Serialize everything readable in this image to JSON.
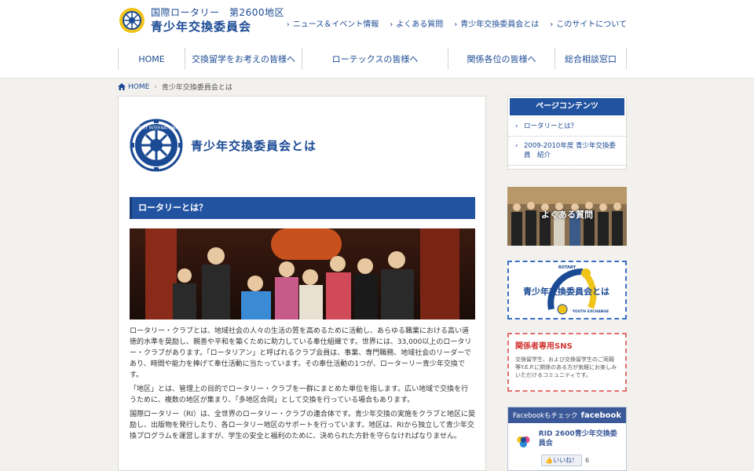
{
  "header": {
    "logo_line1": "国際ロータリー　第2600地区",
    "logo_line2": "青少年交換委員会",
    "top_links": [
      "ニュース＆イベント情報",
      "よくある質問",
      "青少年交換委員会とは",
      "このサイトについて"
    ],
    "nav": [
      "HOME",
      "交換留学をお考えの皆様へ",
      "ローテックスの皆様へ",
      "関係各位の皆様へ",
      "総合相談窓口"
    ]
  },
  "breadcrumb": {
    "home": "HOME",
    "current": "青少年交換委員会とは"
  },
  "main": {
    "title": "青少年交換委員会とは",
    "emblem_text": "ROTARY INTERNATIONAL",
    "section_heading": "ロータリーとは？",
    "paragraphs": [
      "ロータリー・クラブとは、地域社会の人々の生活の質を高めるために活動し、あらゆる職業における高い道徳的水準を奨励し、親善や平和を築くために助力している奉仕組織です。世界には、33,000以上のロータリー・クラブがあります。「ロータリアン」と呼ばれるクラブ会員は、事業、専門職務、地域社会のリーダーであり、時間や能力を捧げて奉仕活動に当たっています。その奉仕活動の1つが、ローターリー青少年交換です。",
      "「地区」とは、管理上の目的でロータリー・クラブを一群にまとめた単位を指します。広い地域で交換を行うために、複数の地区が集まり、「多地区合同」として交換を行っている場合もあります。",
      "国際ロータリー（RI）は、全世界のロータリー・クラブの連合体です。青少年交換の実施をクラブと地区に奨励し、出版物を発行したり、各ロータリー地区のサポートを行っています。地区は、RIから独立して青少年交換プログラムを運営しますが、学生の安全と福利のために、決められた方針を守らなければなりません。"
    ]
  },
  "sidebar": {
    "page_contents_title": "ページコンテンツ",
    "page_contents": [
      "ロータリーとは？",
      "2009-2010年度 青少年交換委員　紹介"
    ],
    "faq_banner": "よくある質問",
    "ye_banner": "青少年交換委員会とは",
    "ye_banner_small_top": "ROTARY",
    "ye_banner_small_bottom": "YOUTH EXCHANGE",
    "sns_title": "関係者専用SNS",
    "sns_desc": "交換留学生、および交換留学生のご両親等Y.E.P.に関係のある方が気軽にお楽しみいただけるコミュニティです。",
    "fb_check": "Facebookもチェック",
    "fb_logo": "facebook",
    "fb_page_name": "RID 2600青少年交換委員会",
    "fb_like": "いいね！",
    "fb_count": "6"
  },
  "colors": {
    "brand_blue": "#1b4a94",
    "heading_blue": "#2253a0",
    "sns_red": "#d0332f",
    "fb_blue": "#3b5998"
  }
}
